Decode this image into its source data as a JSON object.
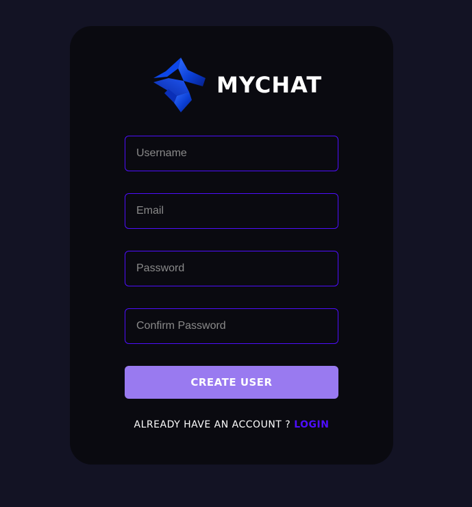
{
  "brand": {
    "name": "MYCHAT",
    "logo_icon": "mychat-logo-icon"
  },
  "form": {
    "username_placeholder": "Username",
    "email_placeholder": "Email",
    "password_placeholder": "Password",
    "confirm_password_placeholder": "Confirm Password",
    "username_value": "",
    "email_value": "",
    "password_value": "",
    "confirm_password_value": "",
    "submit_label": "CREATE USER"
  },
  "footer": {
    "prompt": "ALREADY HAVE AN ACCOUNT ?",
    "login_label": "LOGIN"
  },
  "colors": {
    "page_background": "#131324",
    "card_background": "#0a0a10",
    "input_border": "#4e0eff",
    "button_background": "#997af0",
    "link": "#4e0eff",
    "text": "#ffffff"
  }
}
